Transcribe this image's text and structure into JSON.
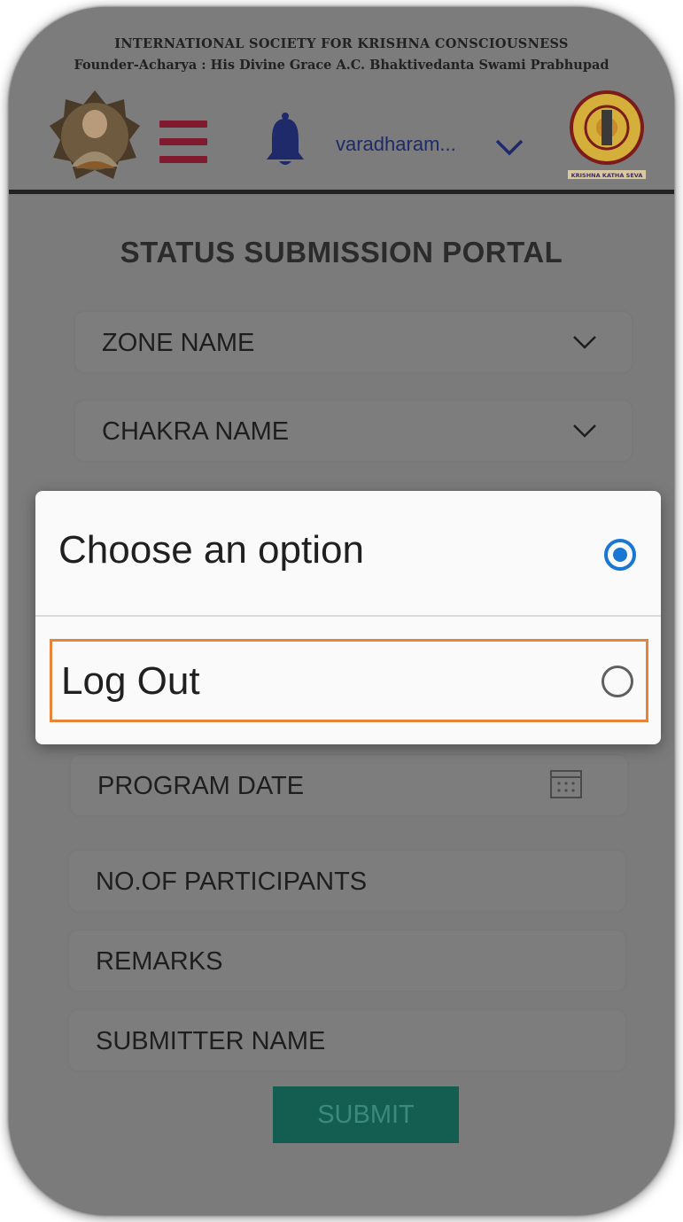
{
  "header": {
    "org_line1": "INTERNATIONAL SOCIETY FOR KRISHNA CONSCIOUSNESS",
    "org_line2": "Founder-Acharya : His Divine Grace A.C. Bhaktivedanta Swami Prabhupad",
    "username": "varadharam...",
    "icons": [
      "portrait-avatar",
      "menu-icon",
      "bell-icon",
      "chevron-down-icon",
      "logo-emblem"
    ],
    "logo_caption": "KRISHNA KATHA SEVA",
    "menu_color": "#801a2e",
    "bell_color": "#1f2a6b"
  },
  "main": {
    "title": "STATUS SUBMISSION PORTAL",
    "fields": {
      "zone": "ZONE NAME",
      "chakra": "CHAKRA NAME",
      "program_date": "PROGRAM DATE",
      "participants": "NO.OF PARTICIPANTS",
      "remarks": "REMARKS",
      "submitter": "SUBMITTER NAME"
    },
    "submit_label": "SUBMIT",
    "submit_color": "#135e51"
  },
  "dialog": {
    "title": "Choose an option",
    "title_selected": true,
    "option_label": "Log Out",
    "option_selected": false,
    "accent": "#1976d2",
    "highlight": "#e8833a"
  }
}
